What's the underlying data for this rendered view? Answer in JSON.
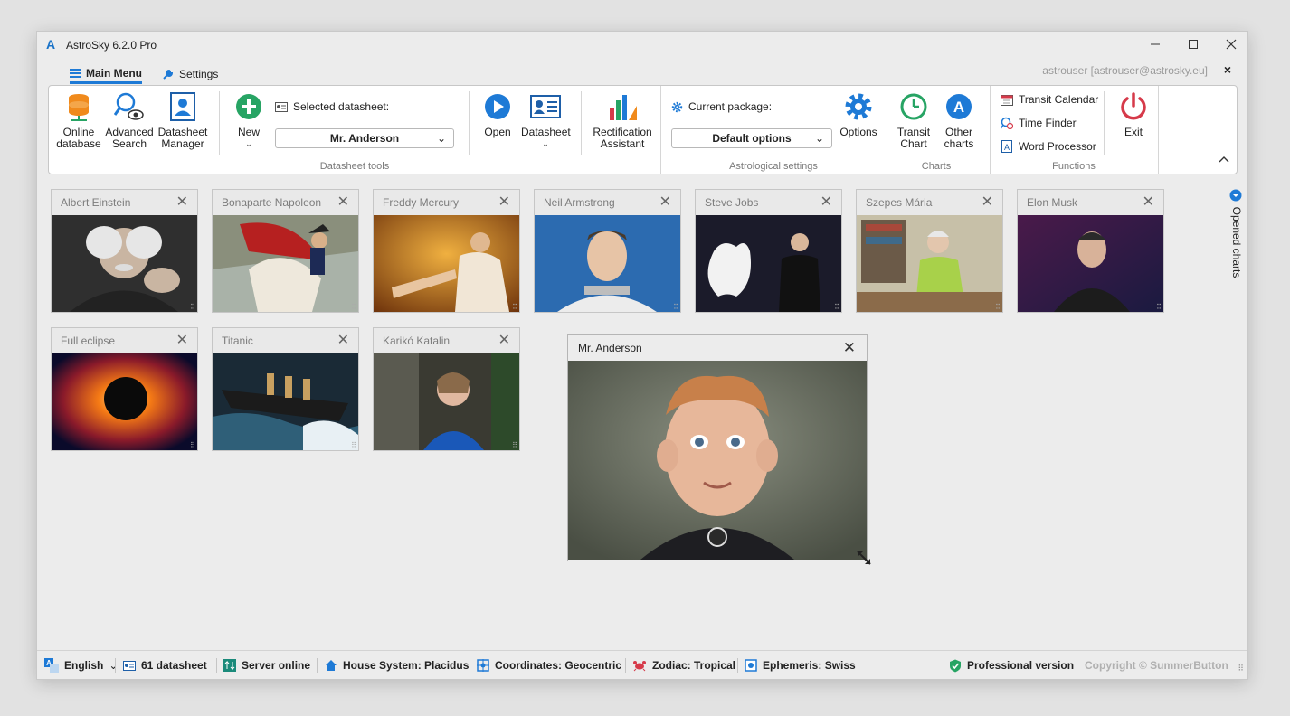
{
  "app": {
    "title": "AstroSky 6.2.0 Pro",
    "logo_letter": "A"
  },
  "window_controls": {
    "minimize": "—",
    "maximize": "☐",
    "close": "✕"
  },
  "menu": {
    "main_label": "Main Menu",
    "settings_label": "Settings"
  },
  "user": {
    "info": "astrouser [astrouser@astrosky.eu]",
    "close": "×"
  },
  "ribbon": {
    "online_database": "Online database",
    "advanced_search": "Advanced Search",
    "datasheet_manager": "Datasheet Manager",
    "new_label": "New",
    "selected_datasheet_label": "Selected datasheet:",
    "selected_datasheet_value": "Mr. Anderson",
    "open_label": "Open",
    "datasheet_label": "Datasheet",
    "rectification_assistant": "Rectification Assistant",
    "datasheet_tools_group": "Datasheet tools",
    "current_package_label": "Current package:",
    "current_package_value": "Default options",
    "options_label": "Options",
    "astrological_settings_group": "Astrological settings",
    "transit_chart": "Transit Chart",
    "other_charts": "Other charts",
    "other_charts_letter": "A",
    "charts_group": "Charts",
    "transit_calendar": "Transit Calendar",
    "time_finder": "Time Finder",
    "word_processor": "Word Processor",
    "functions_group": "Functions",
    "exit_label": "Exit"
  },
  "charts": [
    {
      "name": "Albert Einstein",
      "photo": "portrait-einstein"
    },
    {
      "name": "Bonaparte Napoleon",
      "photo": "painting-napoleon"
    },
    {
      "name": "Freddy Mercury",
      "photo": "concert-mercury"
    },
    {
      "name": "Neil Armstrong",
      "photo": "astronaut-armstrong"
    },
    {
      "name": "Steve Jobs",
      "photo": "keynote-jobs"
    },
    {
      "name": "Szepes Mária",
      "photo": "portrait-szepes"
    },
    {
      "name": "Elon Musk",
      "photo": "portrait-musk"
    },
    {
      "name": "Full eclipse",
      "photo": "solar-eclipse"
    },
    {
      "name": "Titanic",
      "photo": "ship-titanic"
    },
    {
      "name": "Karikó Katalin",
      "photo": "portrait-kariko"
    }
  ],
  "selected_chart": {
    "name": "Mr. Anderson",
    "photo": "cartoon-avatar"
  },
  "opened_charts_label": "Opened charts",
  "status": {
    "language": "English",
    "datasheets": "61 datasheet",
    "server": "Server online",
    "house_system": "House System: Placidus",
    "coordinates": "Coordinates: Geocentric",
    "zodiac": "Zodiac: Tropical",
    "ephemeris": "Ephemeris: Swiss",
    "version": "Professional version",
    "copyright": "Copyright © SummerButton"
  },
  "colors": {
    "accent": "#1e7ad6",
    "exit_red": "#d63a4a",
    "green": "#27a464",
    "orange": "#f08a1c"
  }
}
